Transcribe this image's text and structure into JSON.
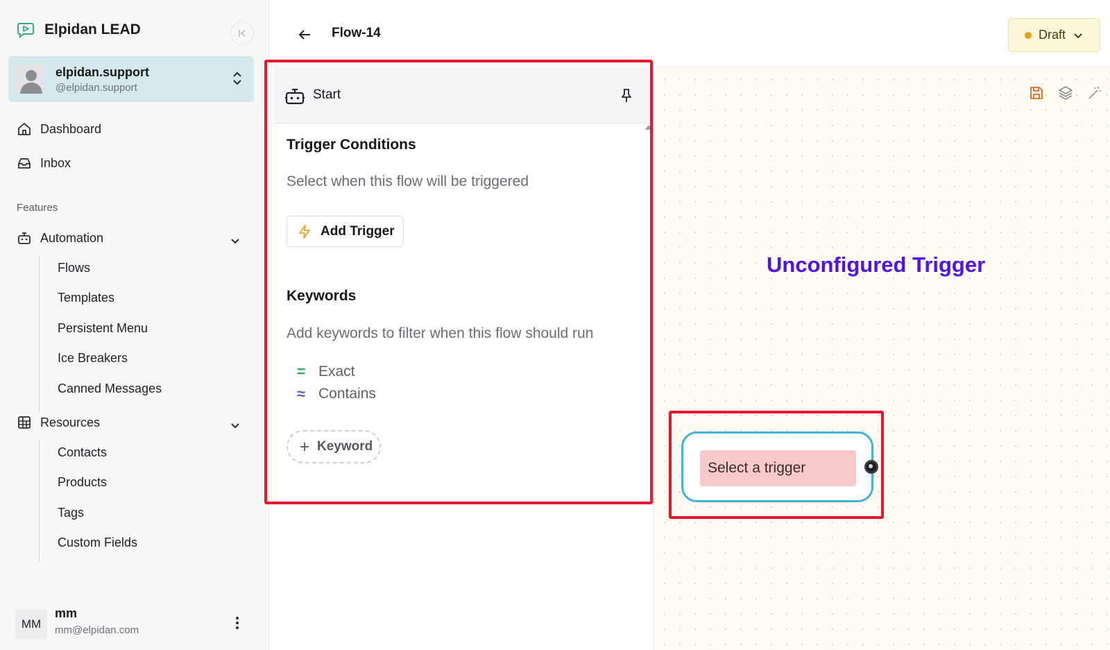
{
  "brand": {
    "name": "Elpidan LEAD",
    "icon": "chat-play-icon"
  },
  "account": {
    "name": "elpidan.support",
    "handle": "@elpidan.support"
  },
  "nav": {
    "dashboard": "Dashboard",
    "inbox": "Inbox",
    "features_label": "Features",
    "automation": {
      "label": "Automation",
      "items": [
        "Flows",
        "Templates",
        "Persistent Menu",
        "Ice Breakers",
        "Canned Messages"
      ]
    },
    "resources": {
      "label": "Resources",
      "items": [
        "Contacts",
        "Products",
        "Tags",
        "Custom Fields"
      ]
    }
  },
  "footer_user": {
    "initials": "MM",
    "name": "mm",
    "email": "mm@elpidan.com"
  },
  "header": {
    "title": "Flow-14",
    "status": "Draft"
  },
  "panel": {
    "title": "Start",
    "trigger_section": {
      "title": "Trigger Conditions",
      "description": "Select when this flow will be triggered",
      "add_button": "Add Trigger"
    },
    "keywords_section": {
      "title": "Keywords",
      "description": "Add keywords to filter when this flow should run",
      "match_types": [
        {
          "symbol": "=",
          "label": "Exact"
        },
        {
          "symbol": "≈",
          "label": "Contains"
        }
      ],
      "add_button": "Keyword"
    }
  },
  "canvas": {
    "annotation": "Unconfigured Trigger",
    "node": {
      "label": "Select a trigger"
    },
    "tools": [
      "save-icon",
      "layers-icon",
      "magic-wand-icon"
    ]
  },
  "colors": {
    "highlight": "#e5182f",
    "annotation": "#4f14e6",
    "node_border": "#3fb3dc",
    "node_pill": "#f7c9cb",
    "account_bg": "#d5e9ea",
    "draft_bg": "#fdf7d9",
    "draft_dot": "#e5a31a"
  }
}
